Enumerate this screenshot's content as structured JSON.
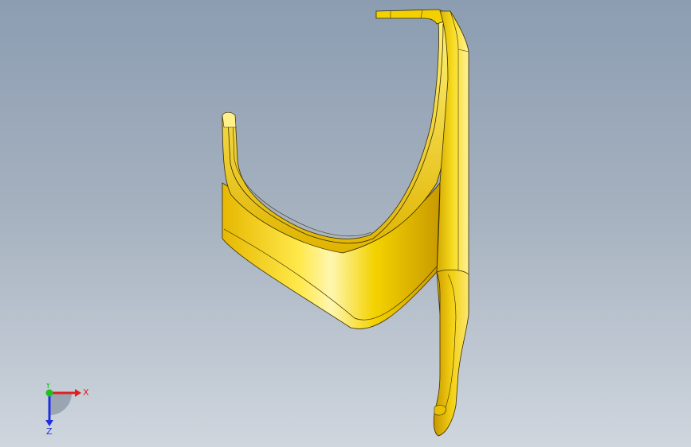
{
  "viewport": {
    "background_top": "#8c9db2",
    "background_bottom": "#cfd6de"
  },
  "model": {
    "part_color": "#f5d800",
    "highlight_color": "#fff7a0",
    "shade_color": "#b88a00",
    "edge_color": "#2a2200"
  },
  "triad": {
    "x_label": "X",
    "y_label": "Y",
    "z_label": "Z",
    "x_color": "#e02020",
    "y_color": "#20c020",
    "z_color": "#2030e0"
  }
}
